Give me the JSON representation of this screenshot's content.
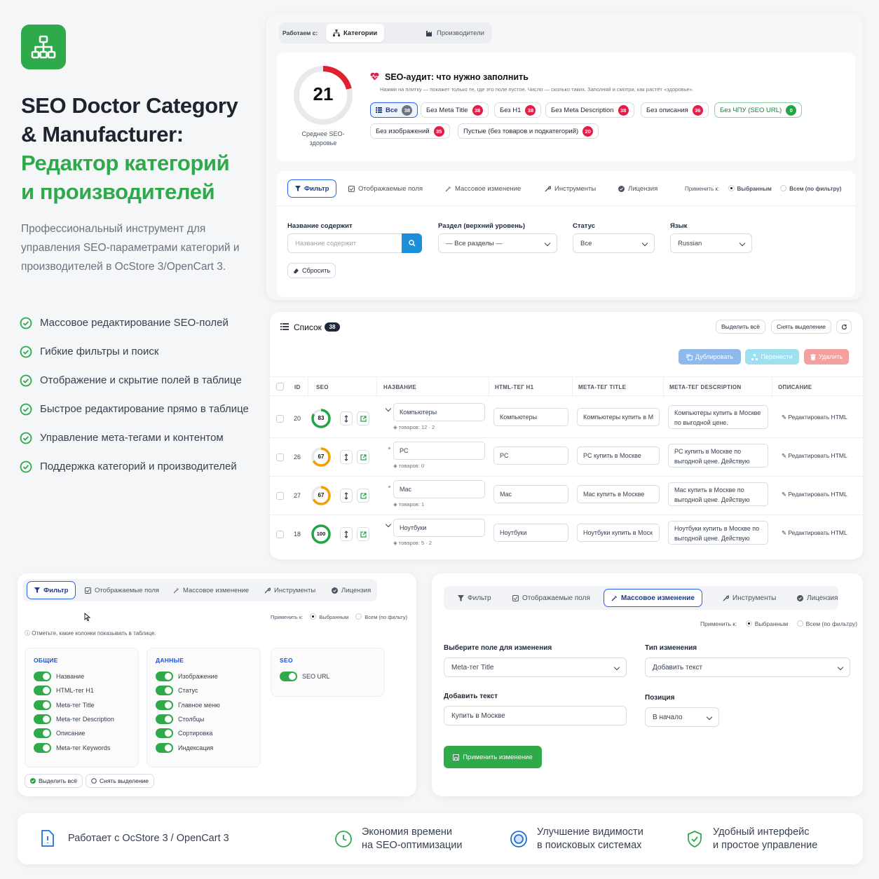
{
  "hero": {
    "title_line1": "SEO Doctor Category",
    "title_line2": "& Manufacturer:",
    "title_line3": "Редактор категорий",
    "title_line4": "и производителей",
    "description": "Профессиональный инструмент для управления SEO-параметрами категорий и производителей в OcStore 3/OpenCart 3.",
    "features": [
      "Массовое редактирование SEO-полей",
      "Гибкие фильтры и поиск",
      "Отображение и скрытие полей в таблице",
      "Быстрое редактирование прямо в таблице",
      "Управление мета-тегами и контентом",
      "Поддержка категорий и производителей"
    ]
  },
  "top": {
    "working_with": "Работаем с:",
    "tab_categories": "Категории",
    "tab_manufacturers": "Производители"
  },
  "audit": {
    "score": "21",
    "score_value": 21,
    "score_label": "Среднее SEO-здоровье",
    "title": "SEO-аудит: что нужно заполнить",
    "subtitle": "Нажми на плитку — покажет только те, где это поле пустое. Число — сколько таких. Заполняй и смотри, как растёт «здоровье».",
    "chips": [
      {
        "label": "Все",
        "count": "38"
      },
      {
        "label": "Без Meta Title",
        "count": "38"
      },
      {
        "label": "Без H1",
        "count": "38"
      },
      {
        "label": "Без Meta Description",
        "count": "38"
      },
      {
        "label": "Без описания",
        "count": "36"
      },
      {
        "label": "Без ЧПУ (SEO URL)",
        "count": "0"
      },
      {
        "label": "Без изображений",
        "count": "35"
      },
      {
        "label": "Пустые (без товаров и подкатегорий)",
        "count": "20"
      }
    ]
  },
  "toolbar": {
    "tabs": [
      "Фильтр",
      "Отображаемые поля",
      "Массовое изменение",
      "Инструменты",
      "Лицензия"
    ],
    "apply_to": "Применить к:",
    "apply_selected": "Выбранным",
    "apply_all": "Всем (по фильтру)"
  },
  "filter": {
    "name_label": "Название содержит",
    "name_placeholder": "Название содержит",
    "section_label": "Раздел (верхний уровень)",
    "section_value": "— Все разделы —",
    "status_label": "Статус",
    "status_value": "Все",
    "lang_label": "Язык",
    "lang_value": "Russian",
    "reset": "Сбросить"
  },
  "list": {
    "title": "Список",
    "count": "38",
    "select_all": "Выделить всё",
    "deselect": "Снять выделение",
    "duplicate": "Дублировать",
    "move": "Перенести",
    "delete": "Удалить",
    "headers": [
      "ID",
      "SEO",
      "НАЗВАНИЕ",
      "HTML-ТЕГ H1",
      "МЕТА-ТЕГ TITLE",
      "МЕТА-ТЕГ DESCRIPTION",
      "ОПИСАНИЕ"
    ],
    "rows": [
      {
        "id": "20",
        "seo": "83",
        "seo_value": 83,
        "name": "Компьютеры",
        "meta": "товаров: 12 · 2",
        "h1": "Компьютеры",
        "title": "Компьютеры купить в М",
        "desc": "Компьютеры купить в Москве по выгодной цене.",
        "edit": "Редактировать HTML",
        "color": "#22a447"
      },
      {
        "id": "26",
        "seo": "67",
        "seo_value": 67,
        "name": "PC",
        "meta": "товаров: 0",
        "h1": "PC",
        "title": "PC купить в Москве",
        "desc": "PC купить в Москве по выгодной цене. Действую",
        "edit": "Редактировать HTML",
        "color": "#f59e0b"
      },
      {
        "id": "27",
        "seo": "67",
        "seo_value": 67,
        "name": "Mac",
        "meta": "товаров: 1",
        "h1": "Mac",
        "title": "Mac купить в Москве",
        "desc": "Mac купить в Москве по выгодной цене. Действую",
        "edit": "Редактировать HTML",
        "color": "#f59e0b"
      },
      {
        "id": "18",
        "seo": "100",
        "seo_value": 100,
        "name": "Ноутбуки",
        "meta": "товаров: 5 · 2",
        "h1": "Ноутбуки",
        "title": "Ноутбуки купить в Моск",
        "desc": "Ноутбуки купить в Москве по выгодной цене. Действую",
        "edit": "Редактировать HTML",
        "color": "#22a447"
      }
    ]
  },
  "fields": {
    "apply_all": "Всем (по фильту)",
    "hint": "Отметьте, какие колонки показывать в таблице.",
    "groups": [
      {
        "title": "ОБЩИЕ",
        "items": [
          "Название",
          "HTML-тег H1",
          "Meta-тег Title",
          "Meta-тег Description",
          "Описание",
          "Meta-тег Keywords"
        ]
      },
      {
        "title": "ДАННЫЕ",
        "items": [
          "Изображение",
          "Статус",
          "Главное меню",
          "Столбцы",
          "Сортировка",
          "Индексация"
        ]
      },
      {
        "title": "SEO",
        "items": [
          "SEO URL"
        ]
      }
    ],
    "select_all": "Выделить всё",
    "deselect": "Снять выделение"
  },
  "mass": {
    "field_label": "Выберите поле для изменения",
    "field_value": "Meta-тег Title",
    "type_label": "Тип изменения",
    "type_value": "Добавить текст",
    "text_label": "Добавить текст",
    "text_value": "Купить в Москве",
    "pos_label": "Позиция",
    "pos_value": "В начало",
    "apply": "Применить изменение"
  },
  "footer": {
    "item1": "Работает с OcStore 3 / OpenCart 3",
    "item2_l1": "Экономия времени",
    "item2_l2": "на SEO-оптимизации",
    "item3_l1": "Улучшение видимости",
    "item3_l2": "в поисковых системах",
    "item4_l1": "Удобный интерфейс",
    "item4_l2": "и простое управление"
  },
  "colors": {
    "brand_green": "#2eaa4a",
    "accent_blue": "#2563eb",
    "danger_red": "#e11d48"
  }
}
